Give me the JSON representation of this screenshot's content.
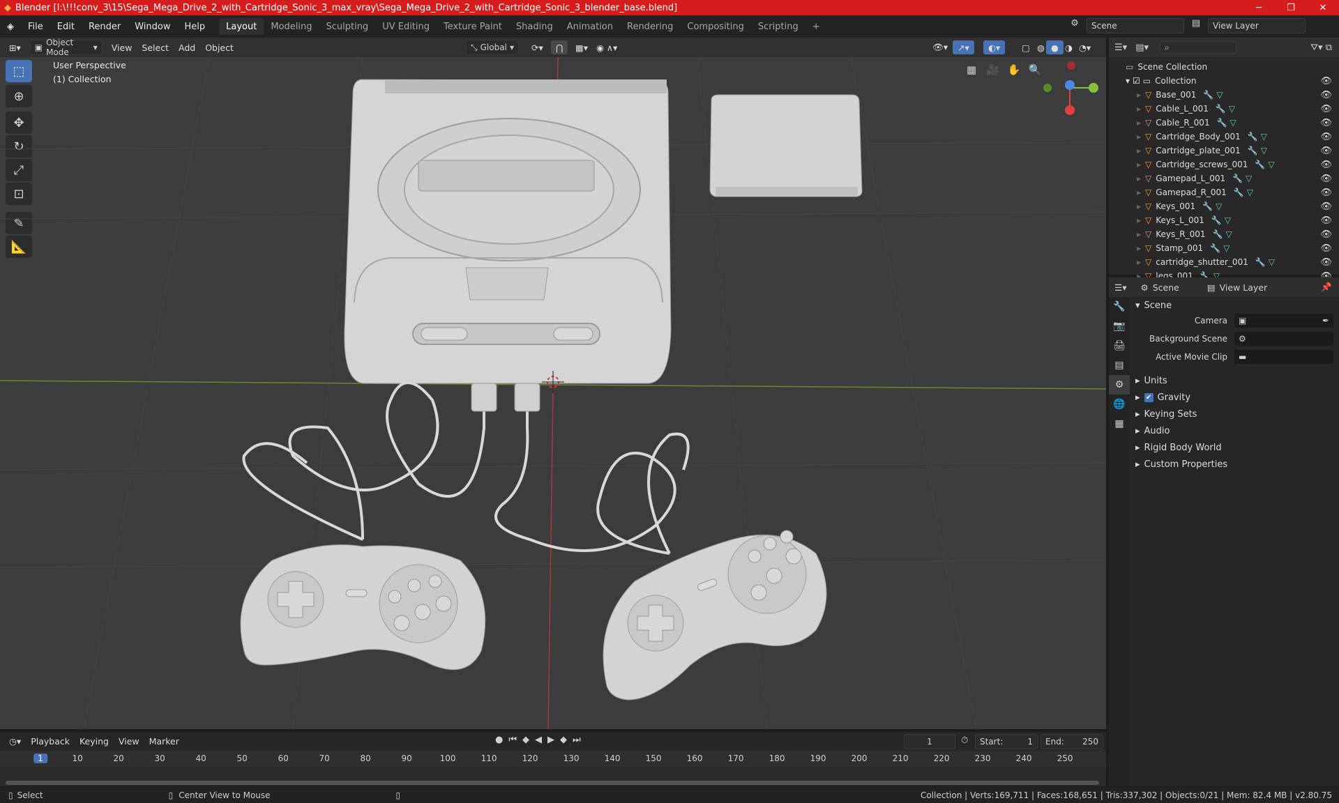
{
  "titlebar": {
    "title": "Blender [I:\\!!!conv_3\\15\\Sega_Mega_Drive_2_with_Cartridge_Sonic_3_max_vray\\Sega_Mega_Drive_2_with_Cartridge_Sonic_3_blender_base.blend]"
  },
  "menu": [
    "File",
    "Edit",
    "Render",
    "Window",
    "Help"
  ],
  "workspaces": [
    "Layout",
    "Modeling",
    "Sculpting",
    "UV Editing",
    "Texture Paint",
    "Shading",
    "Animation",
    "Rendering",
    "Compositing",
    "Scripting"
  ],
  "active_workspace": "Layout",
  "scene_field": "Scene",
  "viewlayer_field": "View Layer",
  "viewport": {
    "mode": "Object Mode",
    "menus": [
      "View",
      "Select",
      "Add",
      "Object"
    ],
    "orientation": "Global",
    "perspective": "User Perspective",
    "collection": "(1) Collection"
  },
  "outliner": {
    "root": "Scene Collection",
    "collection": "Collection",
    "items": [
      "Base_001",
      "Cable_L_001",
      "Cable_R_001",
      "Cartridge_Body_001",
      "Cartridge_plate_001",
      "Cartridge_screws_001",
      "Gamepad_L_001",
      "Gamepad_R_001",
      "Keys_001",
      "Keys_L_001",
      "Keys_R_001",
      "Stamp_001",
      "cartridge_shutter_001",
      "legs_001"
    ]
  },
  "properties": {
    "tabs": [
      "Scene",
      "View Layer"
    ],
    "section": "Scene",
    "camera": "Camera",
    "background_scene": "Background Scene",
    "active_movie_clip": "Active Movie Clip",
    "panels": [
      "Units",
      "Gravity",
      "Keying Sets",
      "Audio",
      "Rigid Body World",
      "Custom Properties"
    ]
  },
  "timeline": {
    "menus": [
      "Playback",
      "Keying",
      "View",
      "Marker"
    ],
    "current_frame": "1",
    "start_label": "Start:",
    "start": "1",
    "end_label": "End:",
    "end": "250",
    "ticks": [
      "1",
      "10",
      "20",
      "30",
      "40",
      "50",
      "60",
      "70",
      "80",
      "90",
      "100",
      "110",
      "120",
      "130",
      "140",
      "150",
      "160",
      "170",
      "180",
      "190",
      "200",
      "210",
      "220",
      "230",
      "240",
      "250"
    ]
  },
  "status": {
    "select": "Select",
    "center": "Center View to Mouse",
    "stats": "Collection | Verts:169,711 | Faces:168,651 | Tris:337,302 | Objects:0/21 | Mem: 82.4 MB | v2.80.75"
  }
}
